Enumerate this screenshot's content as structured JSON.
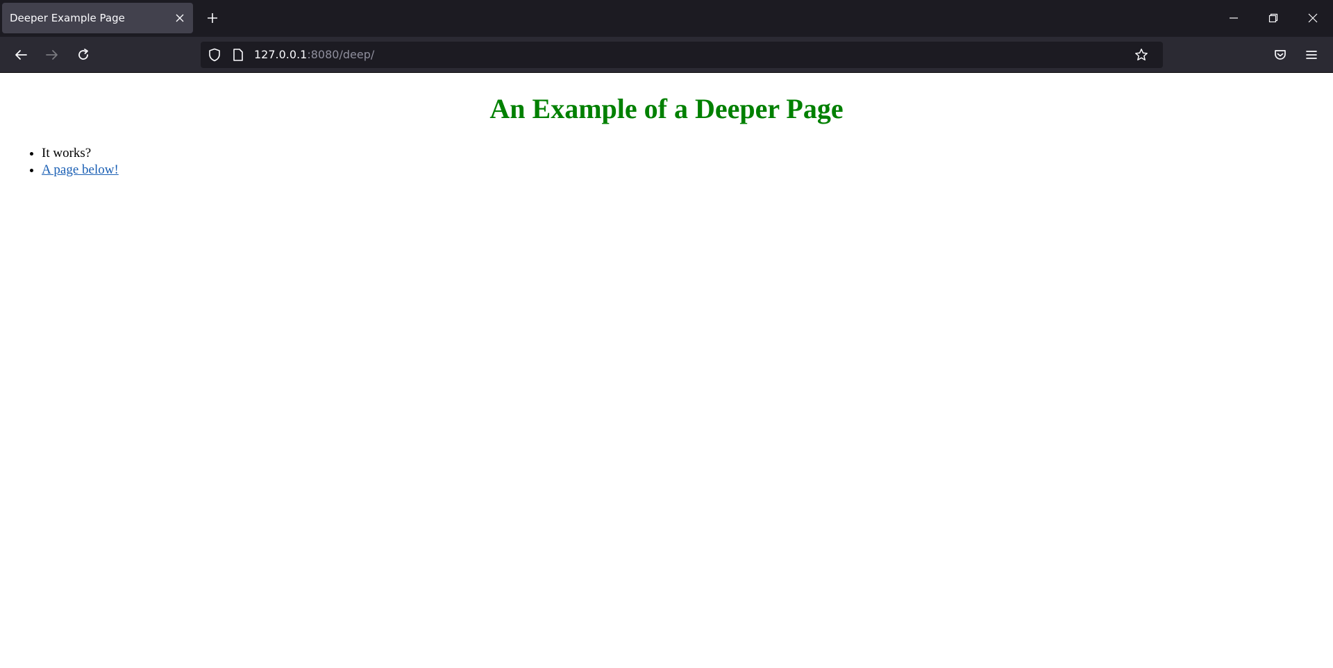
{
  "browser": {
    "tab": {
      "title": "Deeper Example Page",
      "close_icon": "close-icon"
    },
    "new_tab_icon": "plus-icon",
    "window_controls": [
      "minimize-icon",
      "restore-icon",
      "close-icon"
    ],
    "nav": {
      "back_icon": "arrow-left-icon",
      "forward_icon": "arrow-right-icon",
      "reload_icon": "reload-icon"
    },
    "url": {
      "host": "127.0.0.1",
      "rest": ":8080/deep/",
      "shield_icon": "shield-icon",
      "page_icon": "page-icon",
      "bookmark_icon": "star-icon"
    },
    "toolbar_right": [
      "pocket-icon",
      "hamburger-menu-icon"
    ]
  },
  "page": {
    "heading": "An Example of a Deeper Page",
    "heading_color": "#008000",
    "items": [
      {
        "text": "It works?"
      },
      {
        "link_text": "A page below!"
      }
    ]
  },
  "colors": {
    "chrome_dark": "#1c1b22",
    "chrome_nav": "#2b2a33",
    "tab_active": "#42414d",
    "link": "#1a5fb4"
  }
}
